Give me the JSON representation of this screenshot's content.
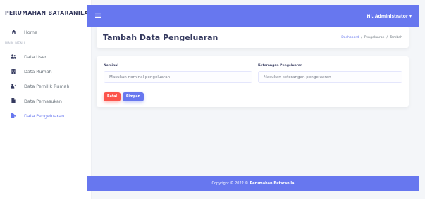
{
  "sidebar": {
    "brand": "PERUMAHAN BATARANILA",
    "home": {
      "label": "Home",
      "icon": "home-icon"
    },
    "menu_header": "MAIN MENU",
    "items": [
      {
        "label": "Data User",
        "icon": "users-icon"
      },
      {
        "label": "Data Rumah",
        "icon": "building-icon"
      },
      {
        "label": "Data Pemilik Rumah",
        "icon": "user-plus-icon"
      },
      {
        "label": "Data Pemasukan",
        "icon": "file-icon"
      },
      {
        "label": "Data Pengeluaran",
        "icon": "file-export-icon",
        "active": true
      }
    ]
  },
  "topbar": {
    "menu_icon": "bars-icon",
    "user_label": "Hi, Administrator ▾"
  },
  "header": {
    "title": "Tambah Data Pengeluaran",
    "breadcrumb": [
      "Dashboard",
      "/",
      "Pengeluaran",
      "/",
      "Tambah"
    ]
  },
  "form": {
    "nominal": {
      "label": "Nominal",
      "placeholder": "Masukan nominal pengeluaran",
      "value": ""
    },
    "keterangan": {
      "label": "Keterangan Pengeluaran",
      "placeholder": "Masukan keterangan pengeluaran",
      "value": ""
    },
    "cancel_label": "Batal",
    "save_label": "Simpan"
  },
  "footer": {
    "copyright": "Copyright © 2022 ©",
    "name": "Perumahan Bataranila"
  },
  "colors": {
    "primary": "#6777ef",
    "danger": "#fc544b",
    "background": "#f4f6f9"
  }
}
